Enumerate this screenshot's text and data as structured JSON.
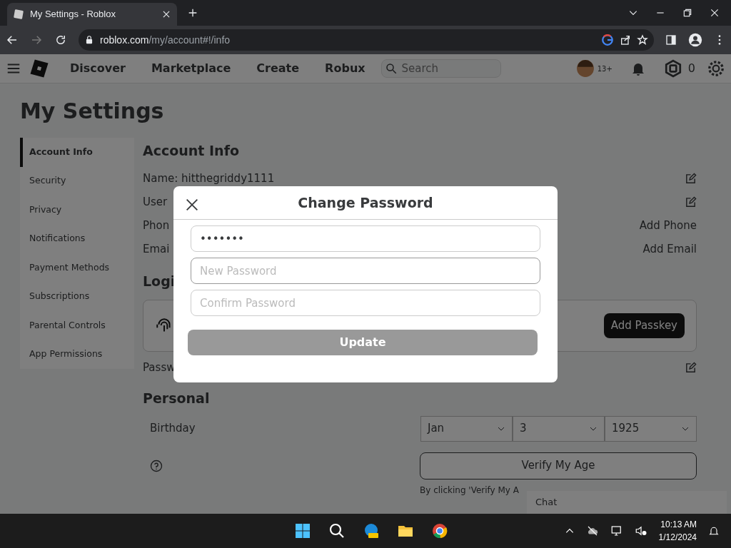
{
  "browser": {
    "tab_title": "My Settings - Roblox",
    "url_domain": "roblox.com",
    "url_path": "/my/account#!/info"
  },
  "nav": {
    "items": [
      "Discover",
      "Marketplace",
      "Create",
      "Robux"
    ],
    "search_placeholder": "Search",
    "age_badge": "13+",
    "robux": "0"
  },
  "page": {
    "title": "My Settings",
    "sidebar": [
      {
        "label": "Account Info",
        "selected": true
      },
      {
        "label": "Security",
        "selected": false
      },
      {
        "label": "Privacy",
        "selected": false
      },
      {
        "label": "Notifications",
        "selected": false
      },
      {
        "label": "Payment Methods",
        "selected": false
      },
      {
        "label": "Subscriptions",
        "selected": false
      },
      {
        "label": "Parental Controls",
        "selected": false
      },
      {
        "label": "App Permissions",
        "selected": false
      }
    ],
    "account_heading": "Account Info",
    "account_rows": [
      {
        "label": "Name: hitthegriddy1111",
        "kind": "edit"
      },
      {
        "label": "User",
        "kind": "edit"
      },
      {
        "label": "Phon",
        "kind": "link",
        "action": "Add Phone"
      },
      {
        "label": "Emai",
        "kind": "link",
        "action": "Add Email"
      }
    ],
    "login_heading": "Logi",
    "passkey_button": "Add Passkey",
    "password_label": "Passw",
    "personal_heading": "Personal",
    "birthday_label": "Birthday",
    "birthday": [
      "Jan",
      "3",
      "1925"
    ],
    "verify_button": "Verify My Age",
    "verify_note": "By clicking 'Verify My A",
    "chat": "Chat"
  },
  "modal": {
    "title": "Change Password",
    "fields": [
      {
        "kind": "password",
        "value": "•••••••",
        "focused": false
      },
      {
        "kind": "input",
        "placeholder": "New Password",
        "focused": true
      },
      {
        "kind": "input",
        "placeholder": "Confirm Password",
        "focused": false
      }
    ],
    "button": {
      "label": "Update",
      "disabled": true
    }
  },
  "taskbar": {
    "time": "10:13 AM",
    "date": "1/12/2024"
  }
}
